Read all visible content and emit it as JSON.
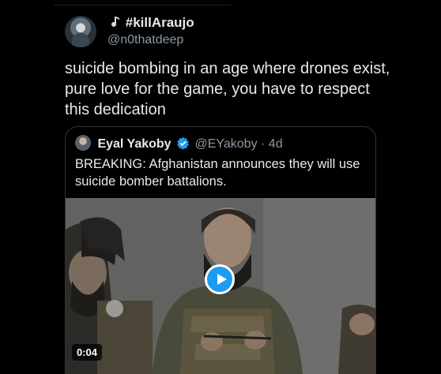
{
  "author": {
    "display_name": "#killAraujo",
    "handle": "@n0thatdeep"
  },
  "tweet": {
    "text": "suicide bombing in an age where drones exist, pure love for the game, you have to respect this dedication"
  },
  "quote": {
    "display_name": "Eyal Yakoby",
    "handle": "@EYakoby",
    "separator": "·",
    "age": "4d",
    "text": "BREAKING: Afghanistan announces they will use suicide bomber battalions.",
    "media": {
      "type": "video",
      "duration": "0:04"
    }
  },
  "colors": {
    "background": "#000000",
    "text": "#e7e9ea",
    "secondary_text": "#8b98a5",
    "accent": "#1d9bf0",
    "border": "#2f3336"
  },
  "icons": [
    "music-note-icon",
    "verified-badge-icon",
    "play-icon"
  ]
}
